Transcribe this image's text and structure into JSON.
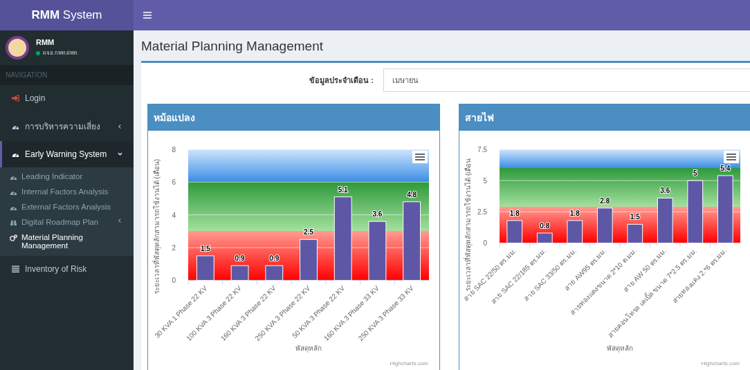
{
  "brand": "**RMM** System",
  "user": {
    "name": "RMM",
    "status": "ผจอ.กพท.ฝพท."
  },
  "nav_header": "NAVIGATION",
  "menu": [
    {
      "label": "Login",
      "selected": false
    },
    {
      "label": "การบริหารความเสี่ยง",
      "selected": false,
      "expanded": false
    },
    {
      "label": "Early Warning System",
      "selected": true,
      "expanded": true,
      "children": [
        {
          "label": "Leading Indicator",
          "selected": false
        },
        {
          "label": "Internal Factors Analysis",
          "selected": false
        },
        {
          "label": "External Factors Analysis",
          "selected": false
        },
        {
          "label": "Digital Roadmap Plan",
          "selected": false,
          "expanded": false
        },
        {
          "label": "Material Planning Management",
          "selected": true
        }
      ]
    },
    {
      "label": "Inventory of Risk",
      "selected": false
    }
  ],
  "page_title": "Material Planning Management",
  "filter": {
    "label": "ข้อมูลประจำเดือน :",
    "value": "เมษายน"
  },
  "panels": [
    {
      "title": "หม้อแปลง",
      "credits": "Highcharts.com",
      "chart_data": {
        "type": "bar",
        "xlabel": "พัสดุหลัก",
        "ylabel": "ระยะเวลาที่พัสดุหลักสามารถใช้งานได้ (เดือน)",
        "categories": [
          "30 KVA 1 Phase 22 KV",
          "100 KVA 3 Phase 22 KV",
          "160 KVA 3 Phase 22 KV",
          "250 KVA 3 Phase 22 KV",
          "50 KVA 3 Phase 22 KV",
          "160 KVA 3 Phase 33 KV",
          "250 KVA 3 Phase 33 KV"
        ],
        "series": [
          {
            "color": "#5d57a6",
            "values": [
              1.5,
              0.9,
              0.9,
              2.5,
              5.1,
              3.6,
              4.8
            ]
          }
        ],
        "ylim": [
          0,
          8
        ],
        "yticks": [
          0,
          2,
          4,
          6,
          8
        ],
        "data_labels": true,
        "grid": true
      }
    },
    {
      "title": "สายไฟ",
      "credits": "Highcharts.com",
      "chart_data": {
        "type": "bar",
        "xlabel": "พัสดุหลัก",
        "ylabel": "ระยะเวลาที่พัสดุหลักสามารถใช้งานได้ (เดือน",
        "categories": [
          "สาย SAC 22/50 ตร.มม.",
          "สาย SAC 22/185 ตร.มม.",
          "สาย SAC 33/50 ตร.มม.",
          "สาย AW95 ตร.มม.",
          "สายทองแดงขนาด 2*10 ต.มม.",
          "สาย AW 50 ตร.มม.",
          "สายคอนโทรล เคเบิ้ล ขนาด 7*2.5 ตร.มม.",
          "สายทองแดง 2.*6 ตร.มม."
        ],
        "series": [
          {
            "color": "#5d57a6",
            "values": [
              1.8,
              0.8,
              1.8,
              2.8,
              1.5,
              3.6,
              5,
              5.4
            ]
          }
        ],
        "ylim": [
          0,
          7.5
        ],
        "yticks": [
          0,
          2.5,
          5,
          7.5
        ],
        "data_labels": true,
        "grid": true
      }
    }
  ]
}
